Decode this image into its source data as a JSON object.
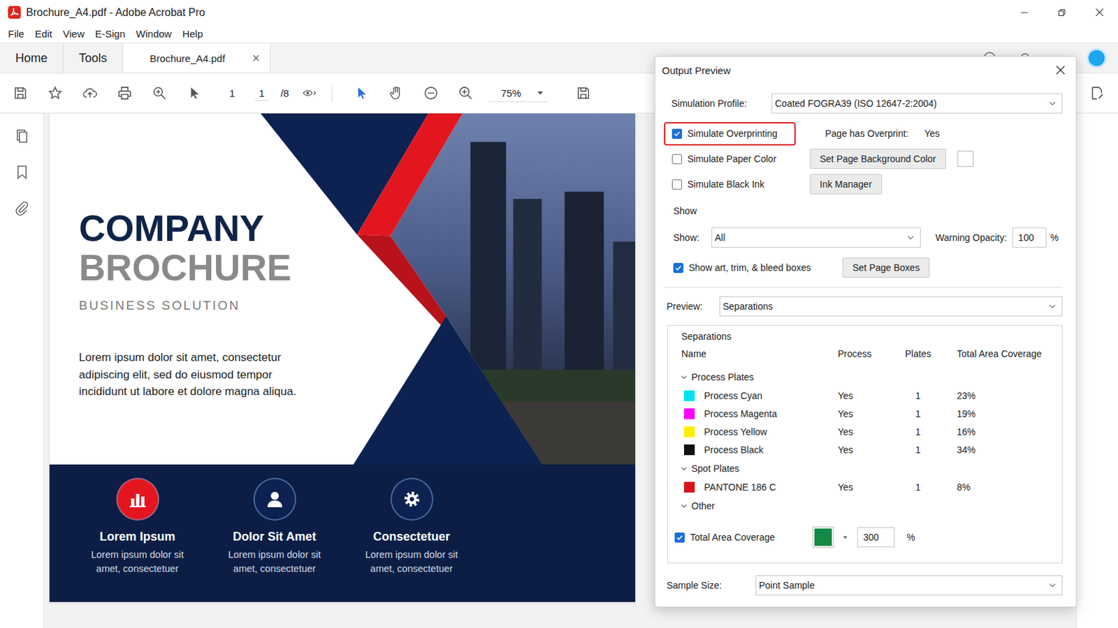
{
  "window": {
    "title": "Brochure_A4.pdf - Adobe Acrobat Pro"
  },
  "menu": [
    "File",
    "Edit",
    "View",
    "E-Sign",
    "Window",
    "Help"
  ],
  "tabs": [
    {
      "label": "Home",
      "selected": false,
      "closable": false
    },
    {
      "label": "Tools",
      "selected": false,
      "closable": false
    },
    {
      "label": "Brochure_A4.pdf",
      "selected": true,
      "closable": true
    }
  ],
  "toolbar": {
    "page_number": "1",
    "page_input": "1",
    "page_total": "/8",
    "zoom": "75%"
  },
  "document": {
    "title_line1": "COMPANY",
    "title_line2": "BROCHURE",
    "subtitle": "BUSINESS SOLUTION",
    "body_lines": [
      "Lorem ipsum dolor sit amet, consectetur",
      "adipiscing elit, sed do eiusmod tempor",
      "incididunt ut labore et dolore magna aliqua."
    ],
    "features": [
      {
        "title": "Lorem Ipsum",
        "lines": [
          "Lorem ipsum dolor sit",
          "amet, consectetuer"
        ],
        "color": "#e3161f"
      },
      {
        "title": "Dolor Sit Amet",
        "lines": [
          "Lorem ipsum dolor sit",
          "amet, consectetuer"
        ],
        "color": "#0d2250"
      },
      {
        "title": "Consectetuer",
        "lines": [
          "Lorem ipsum dolor sit",
          "amet, consectetuer"
        ],
        "color": "#0d2250"
      }
    ]
  },
  "output_preview": {
    "title": "Output Preview",
    "simulation_profile": {
      "label": "Simulation Profile:",
      "value": "Coated FOGRA39 (ISO 12647-2:2004)"
    },
    "options": [
      {
        "label": "Simulate Overprinting",
        "checked": true,
        "highlighted": true
      },
      {
        "label": "Simulate Paper Color",
        "checked": false,
        "highlighted": false
      },
      {
        "label": "Simulate Black Ink",
        "checked": false,
        "highlighted": false
      }
    ],
    "page_overprint": {
      "label": "Page has Overprint:",
      "value": "Yes"
    },
    "background_button": "Set Page Background Color",
    "ink_manager_button": "Ink Manager",
    "show_heading": "Show",
    "show": {
      "label": "Show:",
      "value": "All"
    },
    "warning_opacity": {
      "label": "Warning Opacity:",
      "value": "100",
      "unit": "%"
    },
    "page_boxes": {
      "label": "Show art, trim, & bleed boxes",
      "checked": true
    },
    "set_page_boxes_button": "Set Page Boxes",
    "preview": {
      "label": "Preview:",
      "value": "Separations"
    },
    "separations": {
      "heading": "Separations",
      "columns": [
        "Name",
        "Process",
        "Plates",
        "Total Area Coverage"
      ],
      "groups": [
        {
          "name": "Process Plates",
          "expanded": true,
          "plates": [
            {
              "name": "Process Cyan",
              "process": "Yes",
              "plates": "1",
              "coverage": "23%",
              "color": "#00e3ee"
            },
            {
              "name": "Process Magenta",
              "process": "Yes",
              "plates": "1",
              "coverage": "19%",
              "color": "#ff00ff"
            },
            {
              "name": "Process Yellow",
              "process": "Yes",
              "plates": "1",
              "coverage": "16%",
              "color": "#ffee00"
            },
            {
              "name": "Process Black",
              "process": "Yes",
              "plates": "1",
              "coverage": "34%",
              "color": "#111111"
            }
          ]
        },
        {
          "name": "Spot Plates",
          "expanded": true,
          "plates": [
            {
              "name": "PANTONE 186 C",
              "process": "Yes",
              "plates": "1",
              "coverage": "8%",
              "color": "#d7141a"
            }
          ]
        },
        {
          "name": "Other",
          "expanded": true,
          "plates": []
        }
      ]
    },
    "total_area_coverage": {
      "label": "Total Area Coverage",
      "checked": true,
      "color": "#138a45",
      "value": "300",
      "unit": "%"
    },
    "sample_size": {
      "label": "Sample Size:",
      "value": "Point Sample"
    }
  }
}
